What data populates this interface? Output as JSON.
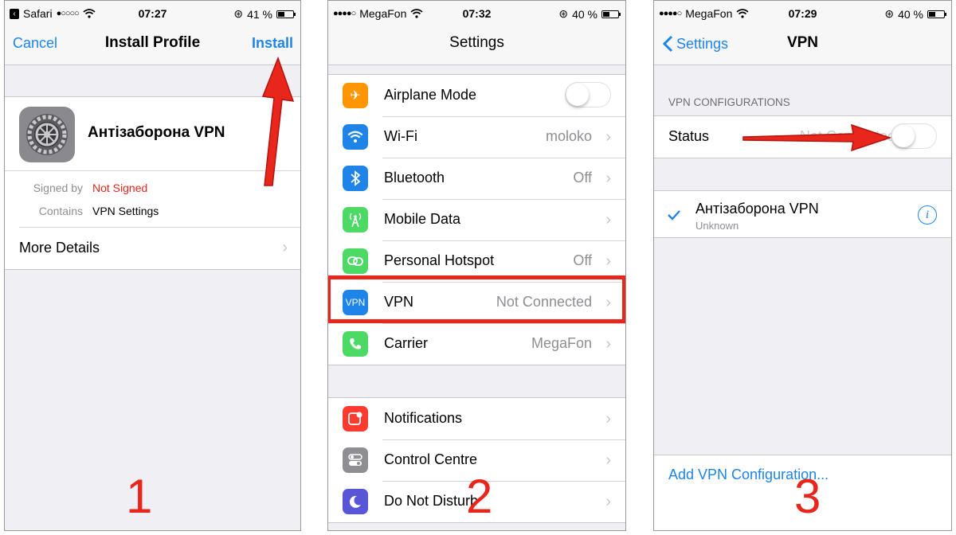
{
  "phone1": {
    "status": {
      "app": "Safari",
      "time": "07:27",
      "battery": "41 %",
      "battery_fraction": 0.41
    },
    "nav": {
      "left": "Cancel",
      "title": "Install Profile",
      "right": "Install"
    },
    "profile": {
      "name": "Антізаборона VPN",
      "signed_by_label": "Signed by",
      "signed_by_value": "Not Signed",
      "contains_label": "Contains",
      "contains_value": "VPN Settings"
    },
    "more_details": "More Details",
    "step": "1"
  },
  "phone2": {
    "status": {
      "carrier": "MegaFon",
      "time": "07:32",
      "battery": "40 %",
      "battery_fraction": 0.4
    },
    "nav": {
      "title": "Settings"
    },
    "rows": [
      {
        "label": "Airplane Mode",
        "value": "",
        "icon": "airplane-icon",
        "color": "#ff9500"
      },
      {
        "label": "Wi-Fi",
        "value": "moloko",
        "icon": "wifi-icon",
        "color": "#1e84e8"
      },
      {
        "label": "Bluetooth",
        "value": "Off",
        "icon": "bluetooth-icon",
        "color": "#1e84e8"
      },
      {
        "label": "Mobile Data",
        "value": "",
        "icon": "antenna-icon",
        "color": "#4cd964"
      },
      {
        "label": "Personal Hotspot",
        "value": "Off",
        "icon": "hotspot-icon",
        "color": "#4cd964"
      },
      {
        "label": "VPN",
        "value": "Not Connected",
        "icon": "vpn-icon",
        "icon_text": "VPN",
        "color": "#1e84e8"
      },
      {
        "label": "Carrier",
        "value": "MegaFon",
        "icon": "phone-icon",
        "color": "#4cd964"
      }
    ],
    "rows2": [
      {
        "label": "Notifications",
        "icon": "notifications-icon",
        "color": "#ff3b30"
      },
      {
        "label": "Control Centre",
        "icon": "control-centre-icon",
        "color": "#8e8e93"
      },
      {
        "label": "Do Not Disturb",
        "icon": "moon-icon",
        "color": "#5856d6"
      }
    ],
    "step": "2"
  },
  "phone3": {
    "status": {
      "carrier": "MegaFon",
      "time": "07:29",
      "battery": "40 %",
      "battery_fraction": 0.4
    },
    "nav": {
      "back": "Settings",
      "title": "VPN"
    },
    "section_header": "VPN CONFIGURATIONS",
    "status_label": "Status",
    "status_value": "Not Connected",
    "config": {
      "name": "Антізаборона VPN",
      "subtitle": "Unknown"
    },
    "add_config": "Add VPN Configuration...",
    "step": "3"
  },
  "colors": {
    "accent": "#1e84e8",
    "annotation_red": "#e8261c",
    "destructive": "#e8261c"
  }
}
